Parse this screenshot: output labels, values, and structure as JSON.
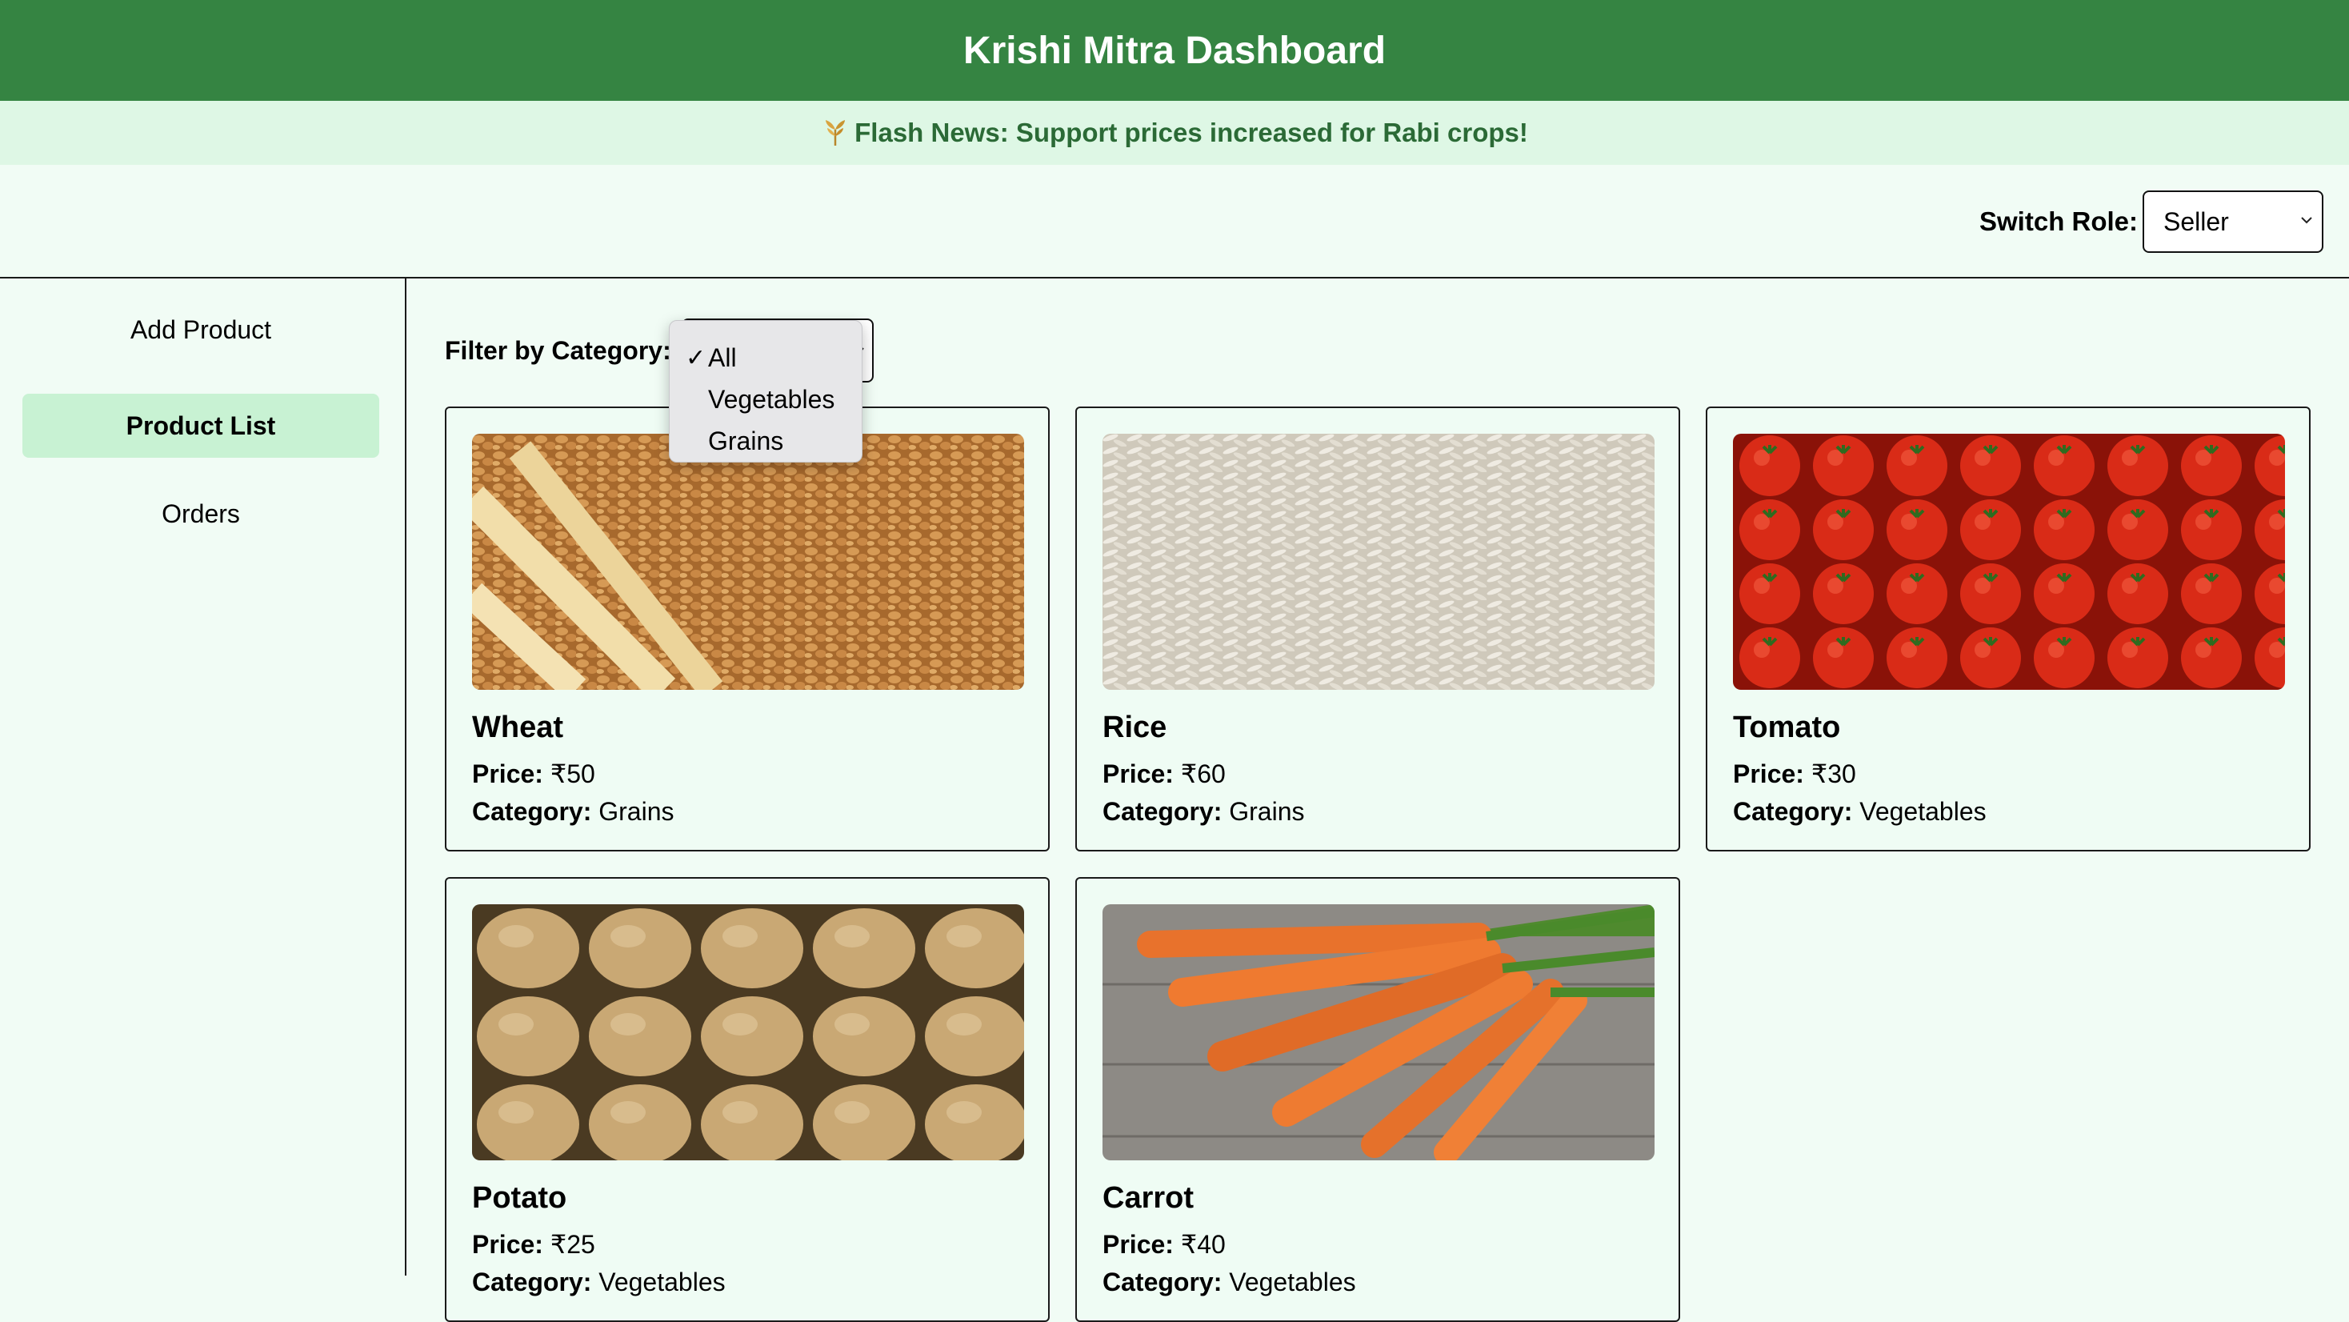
{
  "header": {
    "title": "Krishi Mitra Dashboard"
  },
  "news": {
    "icon": "wheat-sheaf-icon",
    "text": "Flash News: Support prices increased for Rabi crops!"
  },
  "role": {
    "label": "Switch Role:",
    "selected": "Seller"
  },
  "sidebar": {
    "items": [
      {
        "label": "Add Product",
        "active": false
      },
      {
        "label": "Product List",
        "active": true
      },
      {
        "label": "Orders",
        "active": false
      }
    ]
  },
  "filter": {
    "label": "Filter by Category:",
    "options": [
      "All",
      "Vegetables",
      "Grains"
    ],
    "selected": "All",
    "check": "✓"
  },
  "card_labels": {
    "price": "Price:",
    "category": "Category:"
  },
  "products": [
    {
      "name": "Wheat",
      "price": "₹50",
      "category": "Grains"
    },
    {
      "name": "Rice",
      "price": "₹60",
      "category": "Grains"
    },
    {
      "name": "Tomato",
      "price": "₹30",
      "category": "Vegetables"
    },
    {
      "name": "Potato",
      "price": "₹25",
      "category": "Vegetables"
    },
    {
      "name": "Carrot",
      "price": "₹40",
      "category": "Vegetables"
    }
  ],
  "colors": {
    "header_bg": "#358442",
    "news_bg": "#def7e5",
    "page_bg": "#f1fcf5",
    "active_item_bg": "#c8f2d3"
  }
}
